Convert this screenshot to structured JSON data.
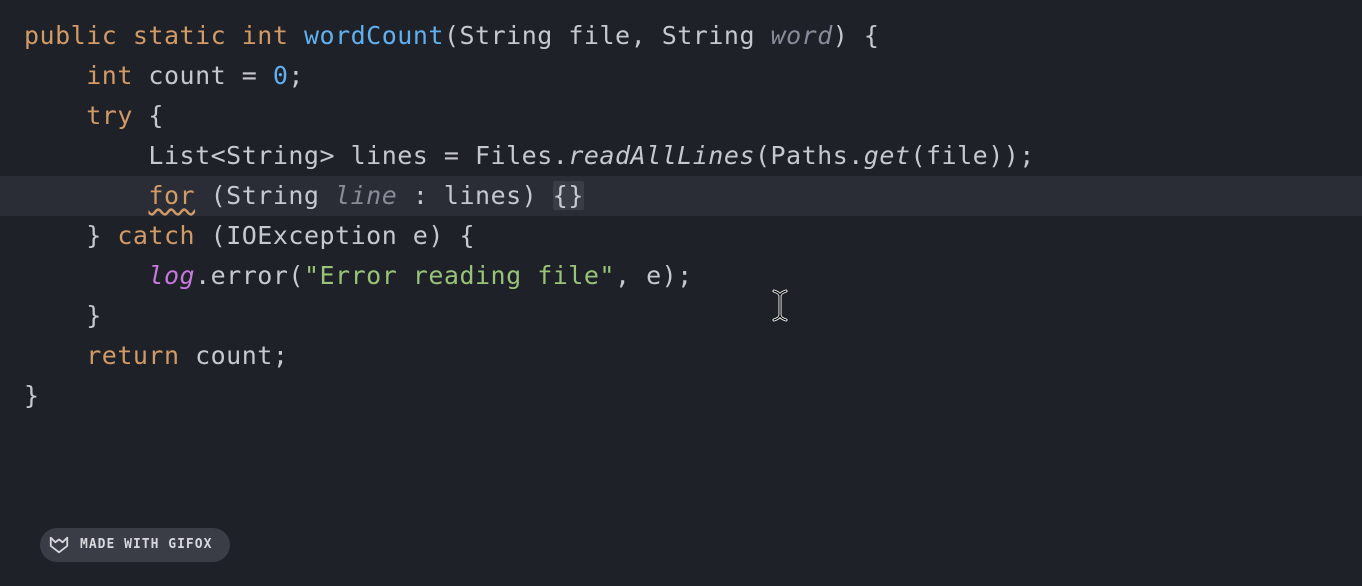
{
  "code": {
    "l1": {
      "public": "public",
      "static": "static",
      "int": "int",
      "method": "wordCount",
      "paren_open": "(",
      "type1": "String",
      "param1": "file",
      "comma": ", ",
      "type2": "String",
      "param2": "word",
      "paren_close": ")",
      "brace": " {"
    },
    "l2": {
      "indent": "    ",
      "int": "int",
      "var": " count = ",
      "zero": "0",
      "semi": ";"
    },
    "l3": {
      "indent": "    ",
      "try": "try",
      "brace": " {"
    },
    "l4": {
      "indent": "        ",
      "list": "List<String> lines = Files.",
      "readAll": "readAllLines",
      "mid": "(Paths.",
      "get": "get",
      "end": "(file));"
    },
    "l5": {
      "indent": "        ",
      "for": "for",
      "sp": " (String ",
      "line": "line",
      "colon": " : lines) ",
      "braces_open": "{",
      "braces_close": "}"
    },
    "l6": {
      "indent": "    ",
      "close": "} ",
      "catch": "catch",
      "args": " (IOException e) {"
    },
    "l7": {
      "indent": "        ",
      "log": "log",
      "error": ".error(",
      "str": "\"Error reading file\"",
      "end": ", e);"
    },
    "l8": {
      "indent": "    ",
      "close": "}"
    },
    "l9": {
      "indent": "    ",
      "return": "return",
      "var": " count;"
    },
    "l10": {
      "close": "}"
    }
  },
  "badge": {
    "text": "MADE WITH GIFOX"
  }
}
